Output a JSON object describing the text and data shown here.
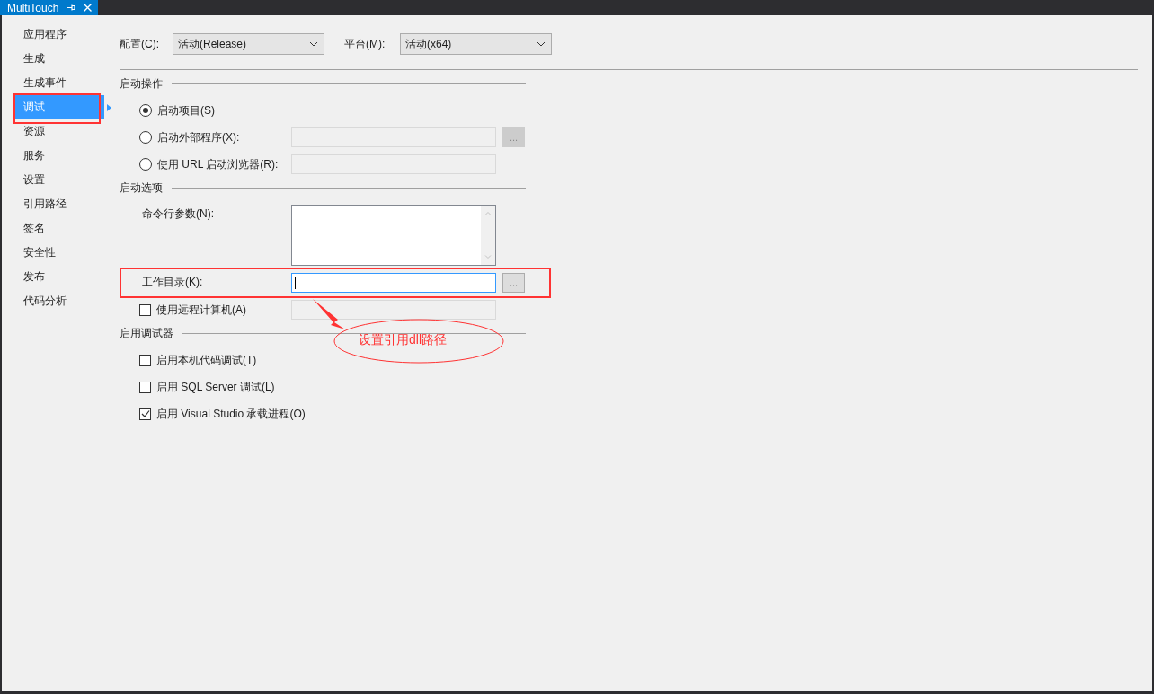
{
  "tab": {
    "title": "MultiTouch",
    "active": true
  },
  "sidebar": {
    "items": [
      {
        "label": "应用程序",
        "selected": false
      },
      {
        "label": "生成",
        "selected": false
      },
      {
        "label": "生成事件",
        "selected": false
      },
      {
        "label": "调试",
        "selected": true
      },
      {
        "label": "资源",
        "selected": false
      },
      {
        "label": "服务",
        "selected": false
      },
      {
        "label": "设置",
        "selected": false
      },
      {
        "label": "引用路径",
        "selected": false
      },
      {
        "label": "签名",
        "selected": false
      },
      {
        "label": "安全性",
        "selected": false
      },
      {
        "label": "发布",
        "selected": false
      },
      {
        "label": "代码分析",
        "selected": false
      }
    ]
  },
  "toolbar": [
    {
      "label": "配置(C):",
      "value": "活动(Release)"
    },
    {
      "label": "平台(M):",
      "value": "活动(x64)"
    }
  ],
  "sections": [
    {
      "title": "启动操作",
      "rows": [
        {
          "kind": "radio",
          "label": "启动项目(S)",
          "selected": true
        },
        {
          "kind": "radio",
          "label": "启动外部程序(X):",
          "selected": false,
          "field": {
            "disabled": true
          },
          "browse": {
            "label": "...",
            "disabled": true
          }
        },
        {
          "kind": "radio",
          "label": "使用 URL 启动浏览器(R):",
          "selected": false,
          "field": {
            "disabled": true
          }
        }
      ]
    },
    {
      "title": "启动选项",
      "rows": [
        {
          "kind": "textarea",
          "label": "命令行参数(N):"
        },
        {
          "kind": "text",
          "label": "工作目录(K):",
          "field": {
            "disabled": false,
            "focused": true
          },
          "browse": {
            "label": "...",
            "disabled": false
          }
        },
        {
          "kind": "checkbox",
          "label": "使用远程计算机(A)",
          "checked": false,
          "field": {
            "disabled": true
          }
        }
      ]
    },
    {
      "title": "启用调试器",
      "rows": [
        {
          "kind": "checkbox",
          "label": "启用本机代码调试(T)",
          "checked": false
        },
        {
          "kind": "checkbox",
          "label": "启用 SQL Server 调试(L)",
          "checked": false
        },
        {
          "kind": "checkbox",
          "label": "启用 Visual Studio 承载进程(O)",
          "checked": true
        }
      ]
    }
  ],
  "annotation": {
    "text": "设置引用dll路径"
  }
}
